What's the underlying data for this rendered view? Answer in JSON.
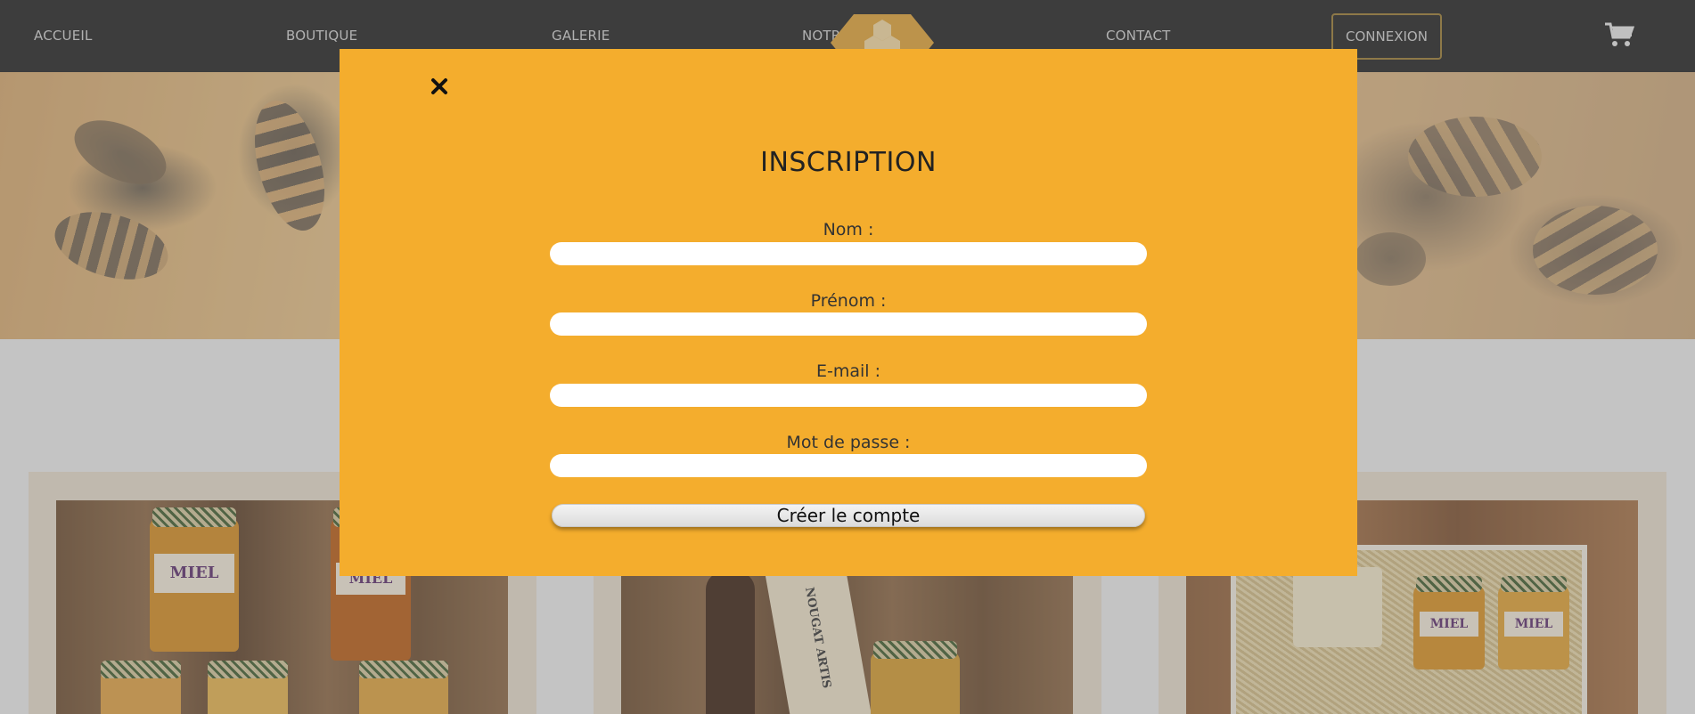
{
  "nav": {
    "accueil": "ACCUEIL",
    "boutique": "BOUTIQUE",
    "galerie": "GALERIE",
    "notre": "NOTR",
    "contact": "CONTACT",
    "connexion": "CONNEXION",
    "cart_icon": "shopping-cart-icon",
    "logo_icon": "honeycomb-logo-icon"
  },
  "modal": {
    "close_icon": "close-icon",
    "title": "INSCRIPTION",
    "fields": [
      {
        "label": "Nom :",
        "value": ""
      },
      {
        "label": "Prénom :",
        "value": ""
      },
      {
        "label": "E-mail :",
        "value": ""
      },
      {
        "label": "Mot de passe :",
        "value": ""
      }
    ],
    "submit_label": "Créer le compte"
  },
  "products": {
    "card1_jar_labels": [
      "MIEL",
      "MIEL"
    ],
    "card2_jar_label": "NOUGAT ARTIS",
    "card3_jar_labels": [
      "MIEL",
      "MIEL"
    ]
  },
  "colors": {
    "modal_bg": "#f4ad2d",
    "navbar_bg": "#1e1e1e",
    "connexion_border": "#9a7a2e"
  }
}
